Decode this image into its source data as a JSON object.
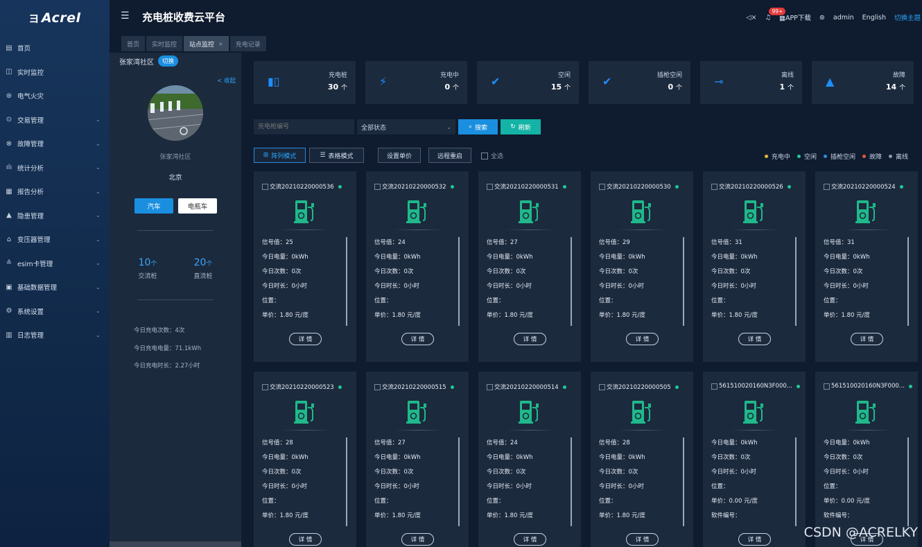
{
  "logo": {
    "mark": "ヨ",
    "text": "Acrel"
  },
  "sidebar": {
    "items": [
      {
        "label": "首页",
        "icon": "grid-icon",
        "glyph": "▤",
        "has_children": false
      },
      {
        "label": "实时监控",
        "icon": "monitor-icon",
        "glyph": "◫",
        "has_children": false
      },
      {
        "label": "电气火灾",
        "icon": "fire-icon",
        "glyph": "⊛",
        "has_children": false
      },
      {
        "label": "交易管理",
        "icon": "coin-icon",
        "glyph": "⊙",
        "has_children": true
      },
      {
        "label": "故障管理",
        "icon": "fault-icon",
        "glyph": "⊗",
        "has_children": true
      },
      {
        "label": "统计分析",
        "icon": "bar-chart-icon",
        "glyph": "ılı",
        "has_children": true
      },
      {
        "label": "报告分析",
        "icon": "report-icon",
        "glyph": "▦",
        "has_children": true
      },
      {
        "label": "隐患管理",
        "icon": "warning-icon",
        "glyph": "▲",
        "has_children": true
      },
      {
        "label": "变压器管理",
        "icon": "transformer-icon",
        "glyph": "⌂",
        "has_children": true
      },
      {
        "label": "esim卡管理",
        "icon": "sim-icon",
        "glyph": "≗",
        "has_children": true
      },
      {
        "label": "基础数据管理",
        "icon": "database-icon",
        "glyph": "▣",
        "has_children": true
      },
      {
        "label": "系统设置",
        "icon": "settings-icon",
        "glyph": "⚙",
        "has_children": true
      },
      {
        "label": "日志管理",
        "icon": "log-icon",
        "glyph": "▥",
        "has_children": true
      }
    ],
    "chevron": "⌄"
  },
  "header": {
    "menu_glyph": "☰",
    "title": "充电桩收费云平台",
    "mute_glyph": "◁×",
    "badge": "99+",
    "app_download": "APP下载",
    "help_glyph": "⊚",
    "user": "admin",
    "language": "English",
    "theme_switch": "切换主题"
  },
  "tabs": [
    {
      "label": "首页",
      "active": false
    },
    {
      "label": "实时监控",
      "active": false
    },
    {
      "label": "站点监控",
      "active": true,
      "closable": true
    },
    {
      "label": "充电记录",
      "active": false
    }
  ],
  "tab_close": "×",
  "station": {
    "name_header": "张家湾社区",
    "switch_label": "切换",
    "collapse_label": "< 收起",
    "name": "张家湾社区",
    "city": "北京",
    "btn_car": "汽车",
    "btn_ebike": "电瓶车",
    "ac_count": "10",
    "dc_count": "20",
    "unit": "个",
    "ac_label": "交流桩",
    "dc_label": "直流桩",
    "today_count": "今日充电次数：4次",
    "today_energy": "今日充电电量：71.1kWh",
    "today_duration": "今日充电时长：2.27小时"
  },
  "summary": [
    {
      "label": "充电桩",
      "value": "30",
      "unit": "个",
      "icon": "charger-icon",
      "glyph": "▮▯"
    },
    {
      "label": "充电中",
      "value": "0",
      "unit": "个",
      "icon": "lightning-icon",
      "glyph": "⚡"
    },
    {
      "label": "空闲",
      "value": "15",
      "unit": "个",
      "icon": "check-circle-icon",
      "glyph": "✔"
    },
    {
      "label": "插枪空闲",
      "value": "0",
      "unit": "个",
      "icon": "check-circle-icon",
      "glyph": "✔"
    },
    {
      "label": "离线",
      "value": "1",
      "unit": "个",
      "icon": "plug-icon",
      "glyph": "⊸"
    },
    {
      "label": "故障",
      "value": "14",
      "unit": "个",
      "icon": "alert-triangle-icon",
      "glyph": "▲"
    }
  ],
  "filter": {
    "code_placeholder": "充电枪编号",
    "status_value": "全部状态",
    "search_label": "搜索",
    "search_glyph": "⌕",
    "refresh_label": "刷新",
    "refresh_glyph": "↻"
  },
  "modes": {
    "array_label": "阵列模式",
    "array_glyph": "⊞",
    "table_label": "表格模式",
    "table_glyph": "☰",
    "set_price": "设置单价",
    "remote_restart": "远程重启",
    "select_all": "全选"
  },
  "legend": [
    {
      "label": "充电中",
      "color": "#e0b83a"
    },
    {
      "label": "空闲",
      "color": "#20c997"
    },
    {
      "label": "插枪空闲",
      "color": "#2a8de0"
    },
    {
      "label": "故障",
      "color": "#e25a3a"
    },
    {
      "label": "离线",
      "color": "#8d9bb0"
    }
  ],
  "cards": [
    {
      "title": "交流20210220000536",
      "rows": [
        "信号值：25",
        "今日电量：0kWh",
        "今日次数：0次",
        "今日时长：0小时",
        "位置：",
        "单价：1.80 元/度"
      ]
    },
    {
      "title": "交流20210220000532",
      "rows": [
        "信号值：24",
        "今日电量：0kWh",
        "今日次数：0次",
        "今日时长：0小时",
        "位置：",
        "单价：1.80 元/度"
      ]
    },
    {
      "title": "交流20210220000531",
      "rows": [
        "信号值：27",
        "今日电量：0kWh",
        "今日次数：0次",
        "今日时长：0小时",
        "位置：",
        "单价：1.80 元/度"
      ]
    },
    {
      "title": "交流20210220000530",
      "rows": [
        "信号值：29",
        "今日电量：0kWh",
        "今日次数：0次",
        "今日时长：0小时",
        "位置：",
        "单价：1.80 元/度"
      ]
    },
    {
      "title": "交流20210220000526",
      "rows": [
        "信号值：31",
        "今日电量：0kWh",
        "今日次数：0次",
        "今日时长：0小时",
        "位置：",
        "单价：1.80 元/度"
      ]
    },
    {
      "title": "交流20210220000524",
      "rows": [
        "信号值：31",
        "今日电量：0kWh",
        "今日次数：0次",
        "今日时长：0小时",
        "位置：",
        "单价：1.80 元/度"
      ]
    },
    {
      "title": "交流20210220000523",
      "rows": [
        "信号值：28",
        "今日电量：0kWh",
        "今日次数：0次",
        "今日时长：0小时",
        "位置：",
        "单价：1.80 元/度"
      ]
    },
    {
      "title": "交流20210220000515",
      "rows": [
        "信号值：27",
        "今日电量：0kWh",
        "今日次数：0次",
        "今日时长：0小时",
        "位置：",
        "单价：1.80 元/度"
      ]
    },
    {
      "title": "交流20210220000514",
      "rows": [
        "信号值：24",
        "今日电量：0kWh",
        "今日次数：0次",
        "今日时长：0小时",
        "位置：",
        "单价：1.80 元/度"
      ]
    },
    {
      "title": "交流20210220000505",
      "rows": [
        "信号值：28",
        "今日电量：0kWh",
        "今日次数：0次",
        "今日时长：0小时",
        "位置：",
        "单价：1.80 元/度"
      ]
    },
    {
      "title": "561510020160N3F000...",
      "rows": [
        "今日电量：0kWh",
        "今日次数：0次",
        "今日时长：0小时",
        "位置：",
        "单价：0.00 元/度",
        "软件编号："
      ]
    },
    {
      "title": "561510020160N3F000...",
      "rows": [
        "今日电量：0kWh",
        "今日次数：0次",
        "今日时长：0小时",
        "位置：",
        "单价：0.00 元/度",
        "软件编号："
      ]
    }
  ],
  "detail_label": "详 情",
  "watermark": "CSDN @ACRELKY",
  "colors": {
    "accent": "#1a8fe0",
    "refresh": "#14b3a6",
    "charger_icon": "#1fb98a",
    "idle": "#20c997"
  }
}
